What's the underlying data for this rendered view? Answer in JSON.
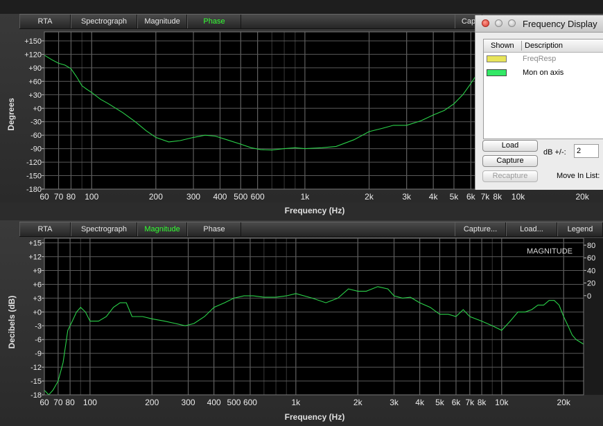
{
  "top_panel": {
    "tabs": [
      {
        "label": "RTA",
        "active": false
      },
      {
        "label": "Spectrograph",
        "active": false
      },
      {
        "label": "Magnitude",
        "active": false
      },
      {
        "label": "Phase",
        "active": true
      }
    ],
    "right_tabs": [
      {
        "label": "Cap"
      }
    ],
    "y_axis_label": "Degrees",
    "x_axis_label": "Frequency (Hz)"
  },
  "bottom_panel": {
    "tabs": [
      {
        "label": "RTA",
        "active": false
      },
      {
        "label": "Spectrograph",
        "active": false
      },
      {
        "label": "Magnitude",
        "active": true
      },
      {
        "label": "Phase",
        "active": false
      }
    ],
    "right_tabs": [
      {
        "label": "Capture..."
      },
      {
        "label": "Load..."
      },
      {
        "label": "Legend"
      }
    ],
    "y_axis_label": "Decibels (dB)",
    "x_axis_label": "Frequency (Hz)",
    "overlay_label": "MAGNITUDE"
  },
  "freq_ticks": [
    {
      "f": 60,
      "label": "60"
    },
    {
      "f": 70,
      "label": "70"
    },
    {
      "f": 80,
      "label": "80"
    },
    {
      "f": 100,
      "label": "100"
    },
    {
      "f": 200,
      "label": "200"
    },
    {
      "f": 300,
      "label": "300"
    },
    {
      "f": 400,
      "label": "400"
    },
    {
      "f": 500,
      "label": "500"
    },
    {
      "f": 600,
      "label": "600"
    },
    {
      "f": 1000,
      "label": "1k"
    },
    {
      "f": 2000,
      "label": "2k"
    },
    {
      "f": 3000,
      "label": "3k"
    },
    {
      "f": 4000,
      "label": "4k"
    },
    {
      "f": 5000,
      "label": "5k"
    },
    {
      "f": 6000,
      "label": "6k"
    },
    {
      "f": 7000,
      "label": "7k"
    },
    {
      "f": 8000,
      "label": "8k"
    },
    {
      "f": 10000,
      "label": "10k"
    },
    {
      "f": 20000,
      "label": "20k"
    }
  ],
  "dialog": {
    "title": "Frequency Display",
    "columns": [
      "Shown",
      "Description"
    ],
    "rows": [
      {
        "label": "FreqResp",
        "color": "#e8e45a",
        "enabled": false
      },
      {
        "label": "Mon on axis",
        "color": "#33e866",
        "enabled": true
      }
    ],
    "load_button": "Load",
    "capture_button": "Capture",
    "recapture_button": "Recapture",
    "db_label": "dB +/-:",
    "db_value": "2",
    "move_label": "Move In List:"
  },
  "colors": {
    "trace": "#2bd24a",
    "active_tab": "#33ff33",
    "grid": "#555555"
  },
  "chart_data": [
    {
      "type": "line",
      "title": "",
      "xlabel": "Frequency (Hz)",
      "ylabel": "Degrees",
      "x_scale": "log",
      "xlim": [
        60,
        25000
      ],
      "ylim": [
        -180,
        170
      ],
      "y_ticks": [
        150,
        120,
        90,
        60,
        30,
        0,
        -30,
        -60,
        -90,
        -120,
        -150,
        -180
      ],
      "y_tick_labels": [
        "+150",
        "+120",
        "+90",
        "+60",
        "+30",
        "+0",
        "-30",
        "-60",
        "-90",
        "-120",
        "-150",
        "-180"
      ],
      "grid": true,
      "series": [
        {
          "name": "",
          "x": [
            60,
            65,
            70,
            75,
            80,
            85,
            90,
            95,
            100,
            110,
            120,
            140,
            160,
            180,
            200,
            230,
            260,
            300,
            340,
            380,
            430,
            500,
            560,
            620,
            700,
            800,
            900,
            1000,
            1200,
            1400,
            1700,
            2000,
            2300,
            2600,
            3000,
            3500,
            4000,
            4500,
            5000,
            5500,
            6000,
            6500,
            7000
          ],
          "y": [
            118,
            108,
            100,
            96,
            88,
            70,
            50,
            42,
            35,
            20,
            10,
            -10,
            -30,
            -50,
            -65,
            -75,
            -72,
            -65,
            -60,
            -62,
            -70,
            -80,
            -88,
            -92,
            -93,
            -90,
            -88,
            -90,
            -88,
            -85,
            -70,
            -52,
            -45,
            -38,
            -38,
            -28,
            -15,
            -5,
            10,
            30,
            55,
            80,
            110
          ]
        }
      ]
    },
    {
      "type": "line",
      "title": "",
      "xlabel": "Frequency (Hz)",
      "ylabel": "Decibels (dB)",
      "x_scale": "log",
      "xlim": [
        60,
        25000
      ],
      "ylim": [
        -18,
        16
      ],
      "y_ticks": [
        15,
        12,
        9,
        6,
        3,
        0,
        -3,
        -6,
        -9,
        -12,
        -15,
        -18
      ],
      "y_tick_labels": [
        "+15",
        "+12",
        "+9",
        "+6",
        "+3",
        "+0",
        "-3",
        "-6",
        "-9",
        "-12",
        "-15",
        "-18"
      ],
      "y2_ticks": [
        80,
        60,
        40,
        20,
        0
      ],
      "y2_tick_labels": [
        "80",
        "60",
        "40",
        "20",
        "0"
      ],
      "grid": true,
      "series": [
        {
          "name": "",
          "x": [
            60,
            63,
            66,
            70,
            74,
            78,
            82,
            86,
            90,
            95,
            100,
            110,
            120,
            130,
            140,
            150,
            160,
            180,
            200,
            230,
            260,
            290,
            320,
            360,
            400,
            450,
            500,
            560,
            620,
            700,
            800,
            900,
            1000,
            1200,
            1400,
            1600,
            1800,
            2000,
            2200,
            2500,
            2800,
            3000,
            3300,
            3600,
            4000,
            4500,
            5000,
            5500,
            6000,
            6500,
            7000,
            8000,
            9000,
            10000,
            11000,
            12000,
            13000,
            14000,
            15000,
            16000,
            17000,
            18000,
            19000,
            20000,
            21000,
            22000,
            23000,
            24000,
            25000
          ],
          "y": [
            -17,
            -18,
            -17,
            -15,
            -11,
            -4,
            -2,
            0,
            1,
            0,
            -2,
            -2,
            -1,
            1,
            2,
            2,
            -1,
            -1,
            -1.5,
            -2,
            -2.5,
            -3,
            -2.5,
            -1,
            1,
            2,
            3,
            3.5,
            3.5,
            3.2,
            3.2,
            3.5,
            4,
            3,
            2,
            3,
            5,
            4.5,
            4.5,
            5.5,
            5,
            3.5,
            3,
            3.2,
            2,
            1,
            -0.5,
            -0.5,
            -1,
            0.5,
            -1,
            -2,
            -3,
            -4,
            -2,
            0,
            0,
            0.5,
            1.5,
            1.5,
            2.5,
            2.5,
            1.5,
            -1,
            -3,
            -5,
            -6,
            -6.5,
            -7
          ]
        }
      ]
    }
  ]
}
